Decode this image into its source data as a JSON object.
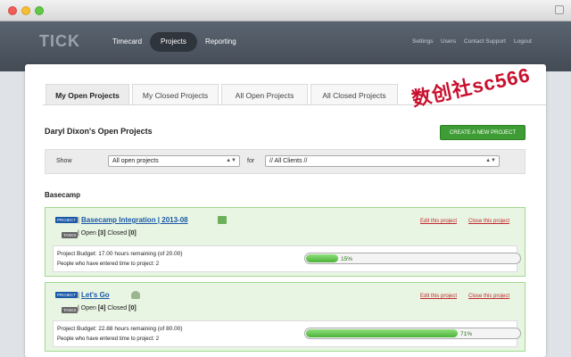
{
  "window": {},
  "app": {
    "logo": "TICK",
    "nav": [
      "Timecard",
      "Projects",
      "Reporting"
    ],
    "right_nav": [
      "Settings",
      "Users",
      "Contact Support",
      "Logout"
    ]
  },
  "tabs": [
    "My Open Projects",
    "My Closed Projects",
    "All Open Projects",
    "All Closed Projects"
  ],
  "page": {
    "title": "Daryl Dixon's Open Projects",
    "create_button": "CREATE A NEW PROJECT",
    "show_label": "Show",
    "show_value": "All open projects",
    "for_label": "for",
    "client_value": "// All Clients //"
  },
  "group": "Basecamp",
  "projects": [
    {
      "tag": "PROJECT",
      "separator": "|",
      "name": "Basecamp Integration | 2013-08",
      "task_tag": "TASKS",
      "status_prefix": "| Open",
      "open": "[3]",
      "closed_label": "Closed",
      "closed": "[0]",
      "edit": "Edit this project",
      "close": "Close this project",
      "budget": "Project Budget: 17.00 hours remaining (of 20.00)",
      "people": "People who have entered time to project: 2",
      "progress": 0.15,
      "progress_label": "15%"
    },
    {
      "tag": "PROJECT",
      "separator": "|",
      "name": "Let's Go",
      "task_tag": "TASKS",
      "status_prefix": "| Open",
      "open": "[4]",
      "closed_label": "Closed",
      "closed": "[0]",
      "edit": "Edit this project",
      "close": "Close this project",
      "budget": "Project Budget: 22.88 hours remaining (of 80.00)",
      "people": "People who have entered time to project: 2",
      "progress": 0.71,
      "progress_label": "71%"
    }
  ],
  "watermark": "数创社sc566"
}
